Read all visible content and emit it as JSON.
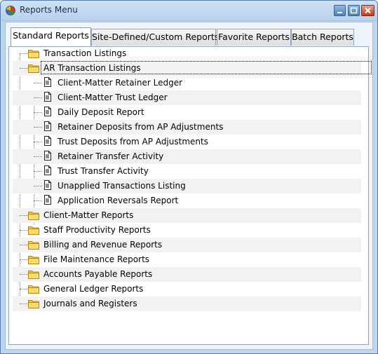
{
  "window": {
    "title": "Reports Menu",
    "app_icon": "report-app-icon",
    "controls": [
      "minimize-icon",
      "maximize-icon",
      "close-icon"
    ]
  },
  "tabs": [
    {
      "label": "Standard Reports",
      "active": true
    },
    {
      "label": "Site-Defined/Custom Reports",
      "active": false
    },
    {
      "label": "Favorite Reports",
      "active": false
    },
    {
      "label": "Batch Reports",
      "active": false
    }
  ],
  "tree": {
    "folder_icon": "folder-icon",
    "report_icon": "report-document-icon",
    "items": [
      {
        "label": "Transaction Listings",
        "type": "folder",
        "level": 0
      },
      {
        "label": "AR Transaction Listings",
        "type": "folder",
        "level": 0,
        "expanded": true,
        "focused": true
      },
      {
        "label": "Client-Matter Retainer Ledger",
        "type": "report",
        "level": 1
      },
      {
        "label": "Client-Matter Trust Ledger",
        "type": "report",
        "level": 1
      },
      {
        "label": "Daily Deposit Report",
        "type": "report",
        "level": 1
      },
      {
        "label": "Retainer Deposits from AP Adjustments",
        "type": "report",
        "level": 1
      },
      {
        "label": "Trust Deposits from AP Adjustments",
        "type": "report",
        "level": 1
      },
      {
        "label": "Retainer Transfer Activity",
        "type": "report",
        "level": 1
      },
      {
        "label": "Trust Transfer Activity",
        "type": "report",
        "level": 1
      },
      {
        "label": "Unapplied Transactions Listing",
        "type": "report",
        "level": 1
      },
      {
        "label": "Application Reversals Report",
        "type": "report",
        "level": 1
      },
      {
        "label": "Client-Matter Reports",
        "type": "folder",
        "level": 0
      },
      {
        "label": "Staff Productivity Reports",
        "type": "folder",
        "level": 0
      },
      {
        "label": "Billing and Revenue Reports",
        "type": "folder",
        "level": 0
      },
      {
        "label": "File Maintenance Reports",
        "type": "folder",
        "level": 0
      },
      {
        "label": "Accounts Payable Reports",
        "type": "folder",
        "level": 0
      },
      {
        "label": "General Ledger Reports",
        "type": "folder",
        "level": 0
      },
      {
        "label": "Journals and Registers",
        "type": "folder",
        "level": 0
      }
    ]
  }
}
